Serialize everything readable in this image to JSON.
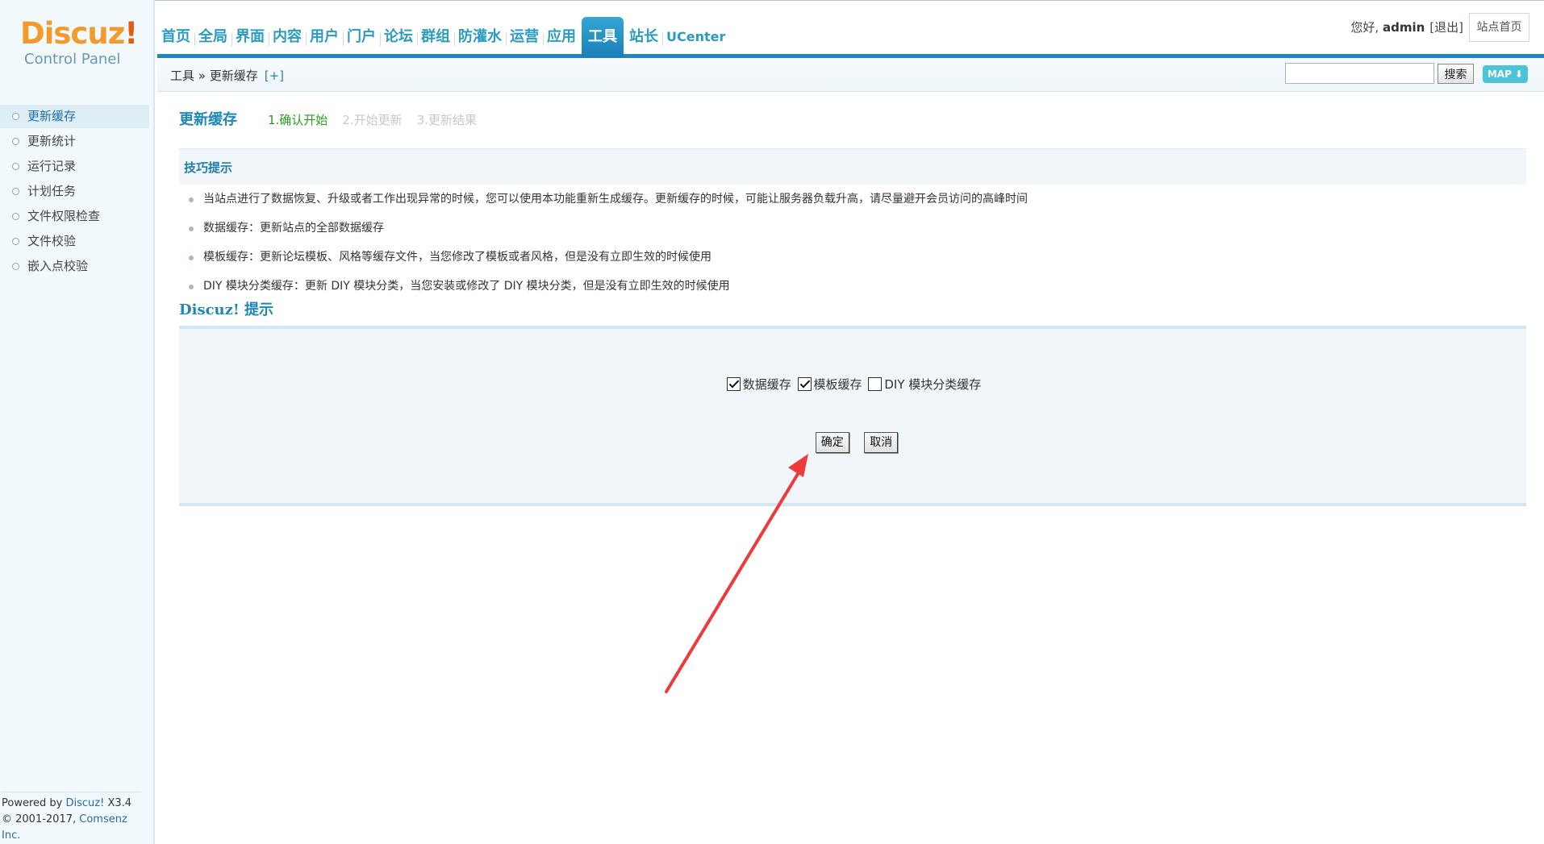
{
  "logo": {
    "brand": "Discuz",
    "brand_mark": "!",
    "subtitle": "Control Panel"
  },
  "topnav": {
    "items": [
      "首页",
      "全局",
      "界面",
      "内容",
      "用户",
      "门户",
      "论坛",
      "群组",
      "防灌水",
      "运营",
      "应用",
      "工具",
      "站长",
      "UCenter"
    ],
    "active": "工具"
  },
  "user": {
    "greeting": "您好, ",
    "name": "admin",
    "logout": "[退出]",
    "site_home": "站点首页"
  },
  "breadcrumb": {
    "text": "工具 » 更新缓存",
    "add": "[+]"
  },
  "search": {
    "value": "",
    "button": "搜索",
    "map": "MAP ⬇"
  },
  "sidebar": {
    "items": [
      {
        "label": "更新缓存",
        "active": true
      },
      {
        "label": "更新统计"
      },
      {
        "label": "运行记录"
      },
      {
        "label": "计划任务"
      },
      {
        "label": "文件权限检查"
      },
      {
        "label": "文件校验"
      },
      {
        "label": "嵌入点校验"
      }
    ],
    "powered_by": "Powered by ",
    "product": "Discuz!",
    "version": " X3.4",
    "copyright": "© 2001-2017, ",
    "company": "Comsenz Inc."
  },
  "main": {
    "title": "更新缓存",
    "steps": [
      "1.确认开始",
      "2.开始更新",
      "3.更新结果"
    ],
    "tips_title": "技巧提示",
    "tips": [
      "当站点进行了数据恢复、升级或者工作出现异常的时候，您可以使用本功能重新生成缓存。更新缓存的时候，可能让服务器负载升高，请尽量避开会员访问的高峰时间",
      "数据缓存：更新站点的全部数据缓存",
      "模板缓存：更新论坛模板、风格等缓存文件，当您修改了模板或者风格，但是没有立即生效的时候使用",
      "DIY 模块分类缓存：更新 DIY 模块分类，当您安装或修改了 DIY 模块分类，但是没有立即生效的时候使用"
    ],
    "discuz_tip": "Discuz! 提示",
    "options": [
      {
        "label": "数据缓存",
        "checked": true
      },
      {
        "label": "模板缓存",
        "checked": true
      },
      {
        "label": "DIY 模块分类缓存",
        "checked": false
      }
    ],
    "confirm": "确定",
    "cancel": "取消"
  },
  "colors": {
    "accent": "#1b88c4",
    "annotation_arrow": "#ee3a3a"
  }
}
